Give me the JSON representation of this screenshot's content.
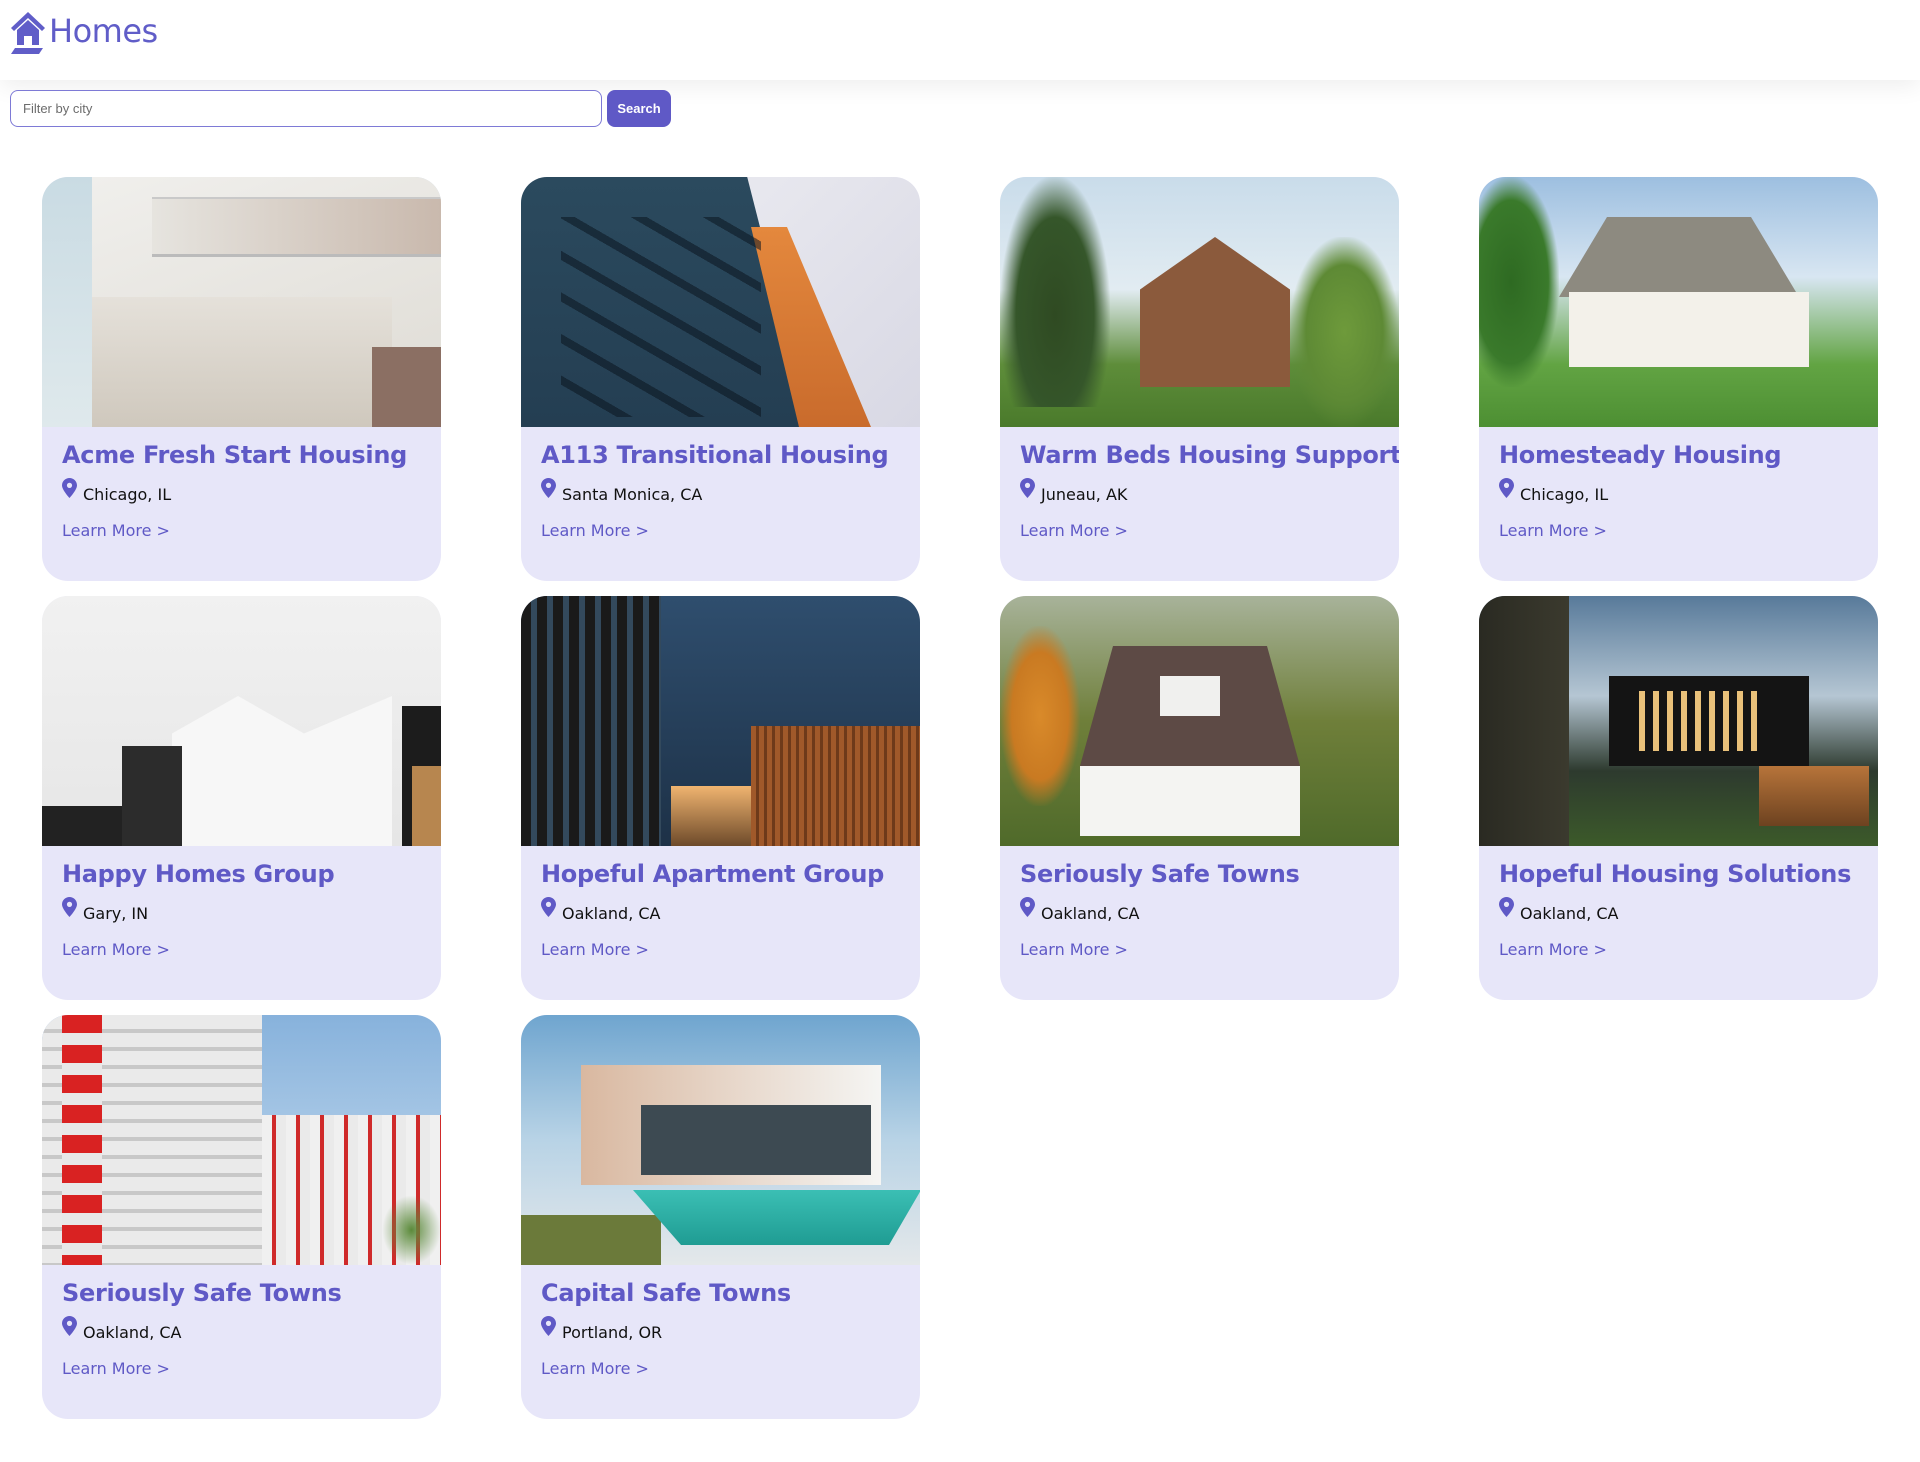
{
  "header": {
    "logo_icon": "house-icon",
    "brand_name": "Homes"
  },
  "filter": {
    "placeholder": "Filter by city",
    "value": "",
    "search_label": "Search"
  },
  "colors": {
    "accent": "#5f59c6",
    "card_background": "#e7e6f9",
    "text": "#111111"
  },
  "listings": [
    {
      "title": "Acme Fresh Start Housing",
      "location": "Chicago, IL",
      "link_label": "Learn More >",
      "photo": "white apartment building with glass balcony"
    },
    {
      "title": "A113 Transitional Housing",
      "location": "Santa Monica, CA",
      "link_label": "Learn More >",
      "photo": "blue and orange apartment block with balconies"
    },
    {
      "title": "Warm Beds Housing Support",
      "location": "Juneau, AK",
      "link_label": "Learn More >",
      "photo": "brown victorian house among trees"
    },
    {
      "title": "Homesteady Housing",
      "location": "Chicago, IL",
      "link_label": "Learn More >",
      "photo": "white cape cod house with lawn"
    },
    {
      "title": "Happy Homes Group",
      "location": "Gary, IN",
      "link_label": "Learn More >",
      "photo": "minimal white and black modern house"
    },
    {
      "title": "Hopeful Apartment Group",
      "location": "Oakland, CA",
      "link_label": "Learn More >",
      "photo": "dark blue modern building with wood slats"
    },
    {
      "title": "Seriously Safe Towns",
      "location": "Oakland, CA",
      "link_label": "Learn More >",
      "photo": "white house with porch and autumn trees"
    },
    {
      "title": "Hopeful Housing Solutions",
      "location": "Oakland, CA",
      "link_label": "Learn More >",
      "photo": "black box modern house at dusk"
    },
    {
      "title": "Seriously Safe Towns",
      "location": "Oakland, CA",
      "link_label": "Learn More >",
      "photo": "red and white high-rise apartment towers"
    },
    {
      "title": "Capital Safe Towns",
      "location": "Portland, OR",
      "link_label": "Learn More >",
      "photo": "modern villa with swimming pool"
    }
  ]
}
